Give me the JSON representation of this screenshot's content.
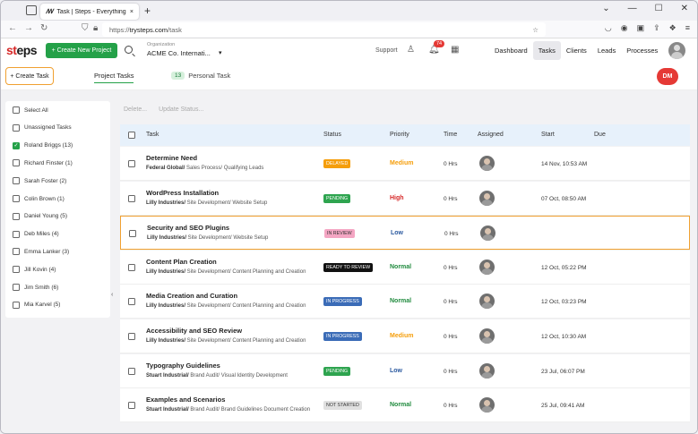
{
  "browser": {
    "tab_title": "Task | Steps - Everything is a pr",
    "tab_close": "×",
    "new_tab": "+",
    "url_scheme": "https://",
    "url_host": "trysteps.com",
    "url_path": "/task",
    "win_min": "—",
    "win_max": "☐",
    "win_close": "✕",
    "back": "←",
    "forward": "→",
    "reload": "↻"
  },
  "header": {
    "logo_s": "st",
    "logo_t": "eps",
    "create_project": "+ Create New Project",
    "org_label": "Organization",
    "org_value": "ACME Co. Internati...",
    "org_caret": "▾",
    "support": "Support",
    "notif_count": "74",
    "nav": [
      "Dashboard",
      "Tasks",
      "Clients",
      "Leads",
      "Processes"
    ],
    "active_nav": "Tasks"
  },
  "subheader": {
    "create_task": "+ Create Task",
    "tab_project": "Project Tasks",
    "tab_personal": "Personal Task",
    "personal_count": "13",
    "dm": "DM"
  },
  "sidebar": {
    "items": [
      {
        "label": "Select All",
        "checked": false
      },
      {
        "label": "Unassigned Tasks",
        "checked": false
      },
      {
        "label": "Roland Briggs (13)",
        "checked": true
      },
      {
        "label": "Richard Finster (1)",
        "checked": false
      },
      {
        "label": "Sarah Foster (2)",
        "checked": false
      },
      {
        "label": "Colin Brown (1)",
        "checked": false
      },
      {
        "label": "Daniel Young (5)",
        "checked": false
      },
      {
        "label": "Deb Miles (4)",
        "checked": false
      },
      {
        "label": "Emma Lanker (3)",
        "checked": false
      },
      {
        "label": "Jill Kovin (4)",
        "checked": false
      },
      {
        "label": "Jim Smith (6)",
        "checked": false
      },
      {
        "label": "Mia Karvel (5)",
        "checked": false
      }
    ],
    "collapse": "‹"
  },
  "table": {
    "bulk_delete": "Delete...",
    "bulk_status": "Update Status...",
    "columns": [
      "Task",
      "Status",
      "Priority",
      "Time",
      "Assigned",
      "Start",
      "Due"
    ],
    "rows": [
      {
        "name": "Determine Need",
        "client": "Federal Global/",
        "path": " Sales Process/ Qualifying Leads",
        "status": "DELAYED",
        "status_color": "#f59e0b",
        "priority": "Medium",
        "priority_color": "#f59e0b",
        "time": "0 Hrs",
        "start": "14 Nov, 10:53 AM"
      },
      {
        "name": "WordPress Installation",
        "client": "Lilly Industries/",
        "path": " Site Development/ Website Setup",
        "status": "PENDING",
        "status_color": "#2ea44f",
        "priority": "High",
        "priority_color": "#d62828",
        "time": "0 Hrs",
        "start": "07 Oct, 08:50 AM"
      },
      {
        "name": "Security and SEO Plugins",
        "client": "Lilly Industries/",
        "path": " Site Development/ Website Setup",
        "status": "IN REVIEW",
        "status_color": "#f4a6c3",
        "priority": "Low",
        "priority_color": "#2c5aa0",
        "time": "0 Hrs",
        "start": ""
      },
      {
        "name": "Content Plan Creation",
        "client": "Lilly Industries/",
        "path": " Site Development/ Content Planning and Creation",
        "status": "READY TO REVIEW",
        "status_color": "#111111",
        "priority": "Normal",
        "priority_color": "#1f8a3d",
        "time": "0 Hrs",
        "start": "12 Oct, 05:22 PM"
      },
      {
        "name": "Media Creation and Curation",
        "client": "Lilly Industries/",
        "path": " Site Development/ Content Planning and Creation",
        "status": "IN PROGRESS",
        "status_color": "#3b6cb7",
        "priority": "Normal",
        "priority_color": "#1f8a3d",
        "time": "0 Hrs",
        "start": "12 Oct, 03:23 PM"
      },
      {
        "name": "Accessibility and SEO Review",
        "client": "Lilly Industries/",
        "path": " Site Development/ Content Planning and Creation",
        "status": "IN PROGRESS",
        "status_color": "#3b6cb7",
        "priority": "Medium",
        "priority_color": "#f59e0b",
        "time": "0 Hrs",
        "start": "12 Oct, 10:30 AM"
      },
      {
        "name": "Typography Guidelines",
        "client": "Stuart Industrial/",
        "path": " Brand Audit/ Visual Identity Development",
        "status": "PENDING",
        "status_color": "#2ea44f",
        "priority": "Low",
        "priority_color": "#2c5aa0",
        "time": "0 Hrs",
        "start": "23 Jul, 06:07 PM"
      },
      {
        "name": "Examples and Scenarios",
        "client": "Stuart Industrial/",
        "path": " Brand Audit/ Brand Guidelines Document Creation",
        "status": "NOT STARTED",
        "status_color": "#e0e0e0",
        "priority": "Normal",
        "priority_color": "#1f8a3d",
        "time": "0 Hrs",
        "start": "25 Jul, 09:41 AM"
      }
    ]
  }
}
